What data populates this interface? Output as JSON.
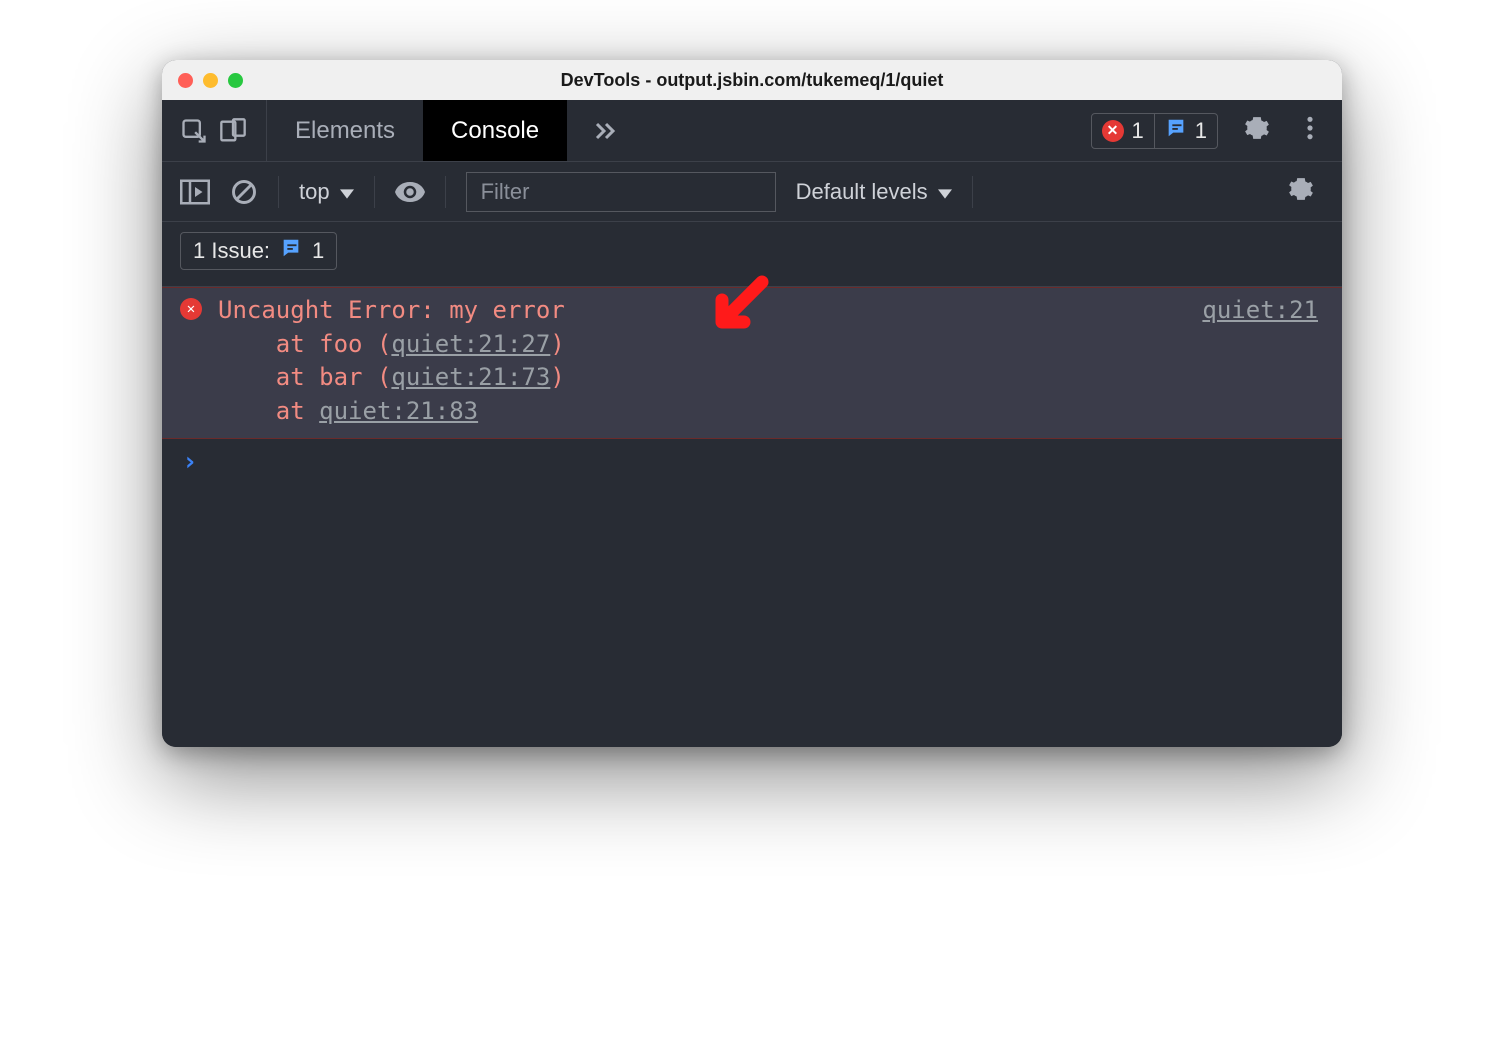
{
  "window": {
    "title": "DevTools - output.jsbin.com/tukemeq/1/quiet"
  },
  "tabs": {
    "elements": "Elements",
    "console": "Console"
  },
  "badges": {
    "error_count": "1",
    "issue_count": "1"
  },
  "toolbar": {
    "context": "top",
    "filter_placeholder": "Filter",
    "levels": "Default levels"
  },
  "issues_row": {
    "label": "1 Issue:",
    "count": "1"
  },
  "error": {
    "title": "Uncaught Error: my error",
    "source": "quiet:21",
    "frames": [
      {
        "prefix": "    at foo (",
        "link": "quiet:21:27",
        "suffix": ")"
      },
      {
        "prefix": "    at bar (",
        "link": "quiet:21:73",
        "suffix": ")"
      },
      {
        "prefix": "    at ",
        "link": "quiet:21:83",
        "suffix": ""
      }
    ]
  }
}
